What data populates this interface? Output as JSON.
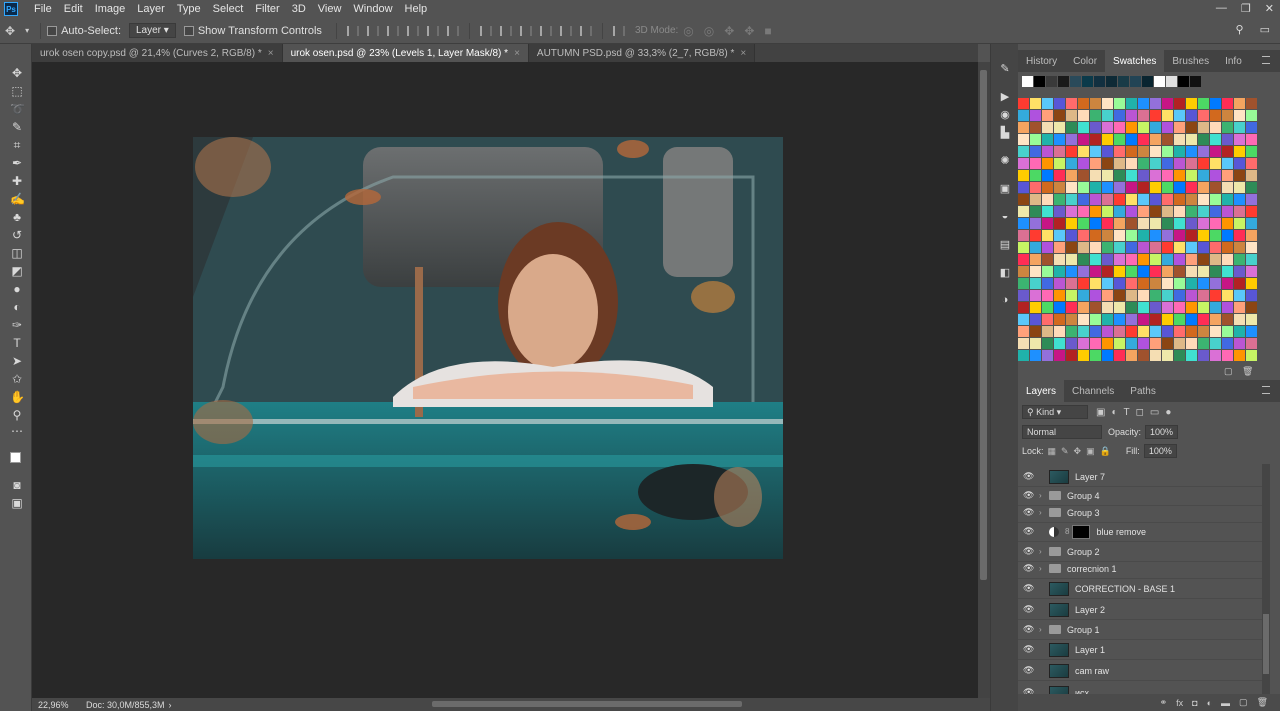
{
  "menubar": {
    "logo": "Ps",
    "items": [
      "File",
      "Edit",
      "Image",
      "Layer",
      "Type",
      "Select",
      "Filter",
      "3D",
      "View",
      "Window",
      "Help"
    ],
    "window_controls": [
      "—",
      "❐",
      "✕"
    ]
  },
  "options": {
    "auto_select_label": "Auto-Select:",
    "auto_select_value": "Layer",
    "transform_label": "Show Transform Controls",
    "mode_3d": "3D Mode:"
  },
  "tabs": [
    {
      "label": "urok osen copy.psd @ 21,4% (Curves 2, RGB/8) *",
      "close": "×"
    },
    {
      "label": "urok osen.psd @ 23% (Levels 1, Layer Mask/8) *",
      "close": "×"
    },
    {
      "label": "AUTUMN PSD.psd @ 33,3% (2_7, RGB/8) *",
      "close": "×"
    }
  ],
  "status": {
    "zoom": "22,96%",
    "doc": "Doc: 30,0M/855,3M"
  },
  "panels": {
    "top_tabs": [
      "History",
      "Color",
      "Swatches",
      "Brushes",
      "Info"
    ],
    "layers_tabs": [
      "Layers",
      "Channels",
      "Paths"
    ],
    "kind_label": "Kind",
    "blend_mode": "Normal",
    "opacity_label": "Opacity:",
    "opacity_value": "100%",
    "lock_label": "Lock:",
    "fill_label": "Fill:",
    "fill_value": "100%"
  },
  "layers": [
    {
      "name": "Layer 7",
      "type": "pixel"
    },
    {
      "name": "Group 4",
      "type": "group"
    },
    {
      "name": "Group 3",
      "type": "group"
    },
    {
      "name": "blue remove",
      "type": "adjustment"
    },
    {
      "name": "Group 2",
      "type": "group"
    },
    {
      "name": "correcnion 1",
      "type": "group"
    },
    {
      "name": "CORRECTION - BASE  1",
      "type": "pixel"
    },
    {
      "name": "Layer 2",
      "type": "pixel"
    },
    {
      "name": "Group 1",
      "type": "group"
    },
    {
      "name": "Layer 1",
      "type": "pixel"
    },
    {
      "name": "cam raw",
      "type": "smart"
    },
    {
      "name": "исх",
      "type": "smart"
    }
  ],
  "colors": {
    "accent": "#31a8ff",
    "bg": "#535353",
    "canvas": "#282828"
  }
}
